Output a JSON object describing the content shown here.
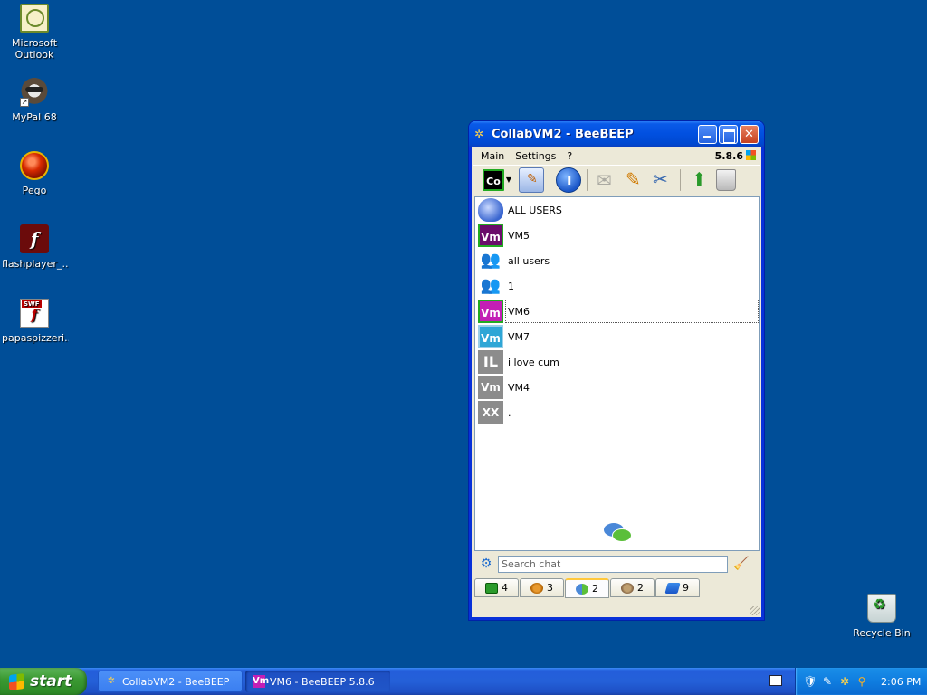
{
  "desktop": {
    "icons": [
      {
        "label": "Microsoft Outlook",
        "icon": "outlook-icon"
      },
      {
        "label": "MyPal 68",
        "icon": "mypal-icon"
      },
      {
        "label": "Pego",
        "icon": "pego-icon"
      },
      {
        "label": "flashplayer_...",
        "icon": "flash-icon"
      },
      {
        "label": "papaspizzeri...",
        "icon": "swf-file-icon"
      },
      {
        "label": "Recycle Bin",
        "icon": "recycle-bin-icon"
      }
    ]
  },
  "window": {
    "title": "CollabVM2 - BeeBEEP",
    "menu": [
      "Main",
      "Settings",
      "?"
    ],
    "version": "5.8.6",
    "status_badge": "Co",
    "toolbar_icons": [
      "status-icon",
      "profile-icon",
      "network-icon",
      "mail-icon",
      "note-icon",
      "tools-icon",
      "update-icon",
      "trash-icon"
    ],
    "users": [
      {
        "name": "ALL USERS",
        "avatar": ""
      },
      {
        "name": "VM5",
        "avatar": "Vm"
      },
      {
        "name": "all users",
        "avatar": ""
      },
      {
        "name": "1",
        "avatar": ""
      },
      {
        "name": "VM6",
        "avatar": "Vm"
      },
      {
        "name": "VM7",
        "avatar": "Vm"
      },
      {
        "name": "i love cum",
        "avatar": "IL"
      },
      {
        "name": "VM4",
        "avatar": "Vm"
      },
      {
        "name": ".",
        "avatar": "XX"
      }
    ],
    "search": {
      "placeholder": "Search chat"
    },
    "tabs": [
      {
        "count": "4",
        "icon": "users-online-icon"
      },
      {
        "count": "3",
        "icon": "groups-icon"
      },
      {
        "count": "2",
        "icon": "chats-icon"
      },
      {
        "count": "2",
        "icon": "group-chats-icon"
      },
      {
        "count": "9",
        "icon": "pins-icon"
      }
    ]
  },
  "taskbar": {
    "start_label": "start",
    "tasks": [
      {
        "label": "CollabVM2 - BeeBEEP"
      },
      {
        "label": "VM6 - BeeBEEP 5.8.6"
      }
    ],
    "clock": "2:06 PM"
  },
  "colors": {
    "desktop": "#004e98",
    "titlebar": "#0150e0",
    "window_bg": "#ece9d8",
    "vm5": "#6a0d6a",
    "vm6": "#c31fb5",
    "vm7": "#2ea6d6"
  }
}
